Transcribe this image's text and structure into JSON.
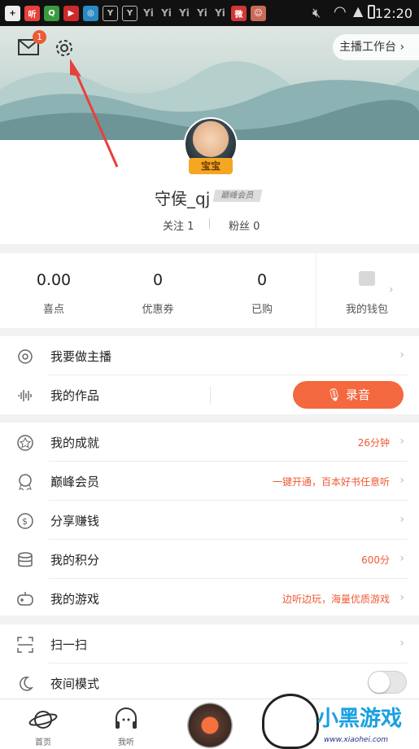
{
  "status_bar": {
    "time": "12:20",
    "icons": [
      "add-icon",
      "ting-icon",
      "q-icon",
      "video-icon",
      "map-icon",
      "yi-icon",
      "yi-icon",
      "yi",
      "yi",
      "yi",
      "yi",
      "yi",
      "weibo-icon",
      "avatar-icon"
    ],
    "icon_text_ting": "听",
    "icon_text_wb": "微"
  },
  "header": {
    "mail_badge": "1",
    "anchor_workbench": "主播工作台 ›"
  },
  "profile": {
    "avatar_badge": "宝宝",
    "nickname": "守侯_qj",
    "vip_badge": "巅峰会员",
    "follow": "关注 1",
    "fans": "粉丝 0"
  },
  "stats": [
    {
      "value": "0.00",
      "label": "喜点"
    },
    {
      "value": "0",
      "label": "优惠券"
    },
    {
      "value": "0",
      "label": "已购"
    }
  ],
  "wallet": {
    "label": "我的钱包",
    "chevron": "›"
  },
  "menu_group1": [
    {
      "label": "我要做主播",
      "value": "",
      "chevron": "›"
    },
    {
      "label": "我的作品",
      "value": "",
      "chevron": ""
    }
  ],
  "record_button": "录音",
  "menu_group2": [
    {
      "label": "我的成就",
      "value": "26分钟",
      "chevron": "›"
    },
    {
      "label": "巅峰会员",
      "value": "一键开通，百本好书任意听",
      "chevron": "›"
    },
    {
      "label": "分享赚钱",
      "value": "",
      "chevron": "›"
    },
    {
      "label": "我的积分",
      "value": "600分",
      "chevron": "›"
    },
    {
      "label": "我的游戏",
      "value": "边听边玩，海量优质游戏",
      "chevron": "›"
    }
  ],
  "menu_group3": [
    {
      "label": "扫一扫",
      "value": "",
      "chevron": "›"
    },
    {
      "label": "夜间模式",
      "value": "",
      "chevron": ""
    }
  ],
  "night_mode": {
    "enabled": false
  },
  "tabs": [
    {
      "label": "首页",
      "icon": "planet-icon"
    },
    {
      "label": "我听",
      "icon": "headphones-icon"
    },
    {
      "label": "",
      "icon": "play-disc-icon"
    }
  ],
  "watermark": {
    "text": "小黑游戏",
    "url": "www.xiaohei.com"
  },
  "colors": {
    "accent": "#f4683f",
    "value_text": "#ef5a34",
    "badge": "#ee5a33",
    "annotation_arrow": "#e8403a"
  }
}
